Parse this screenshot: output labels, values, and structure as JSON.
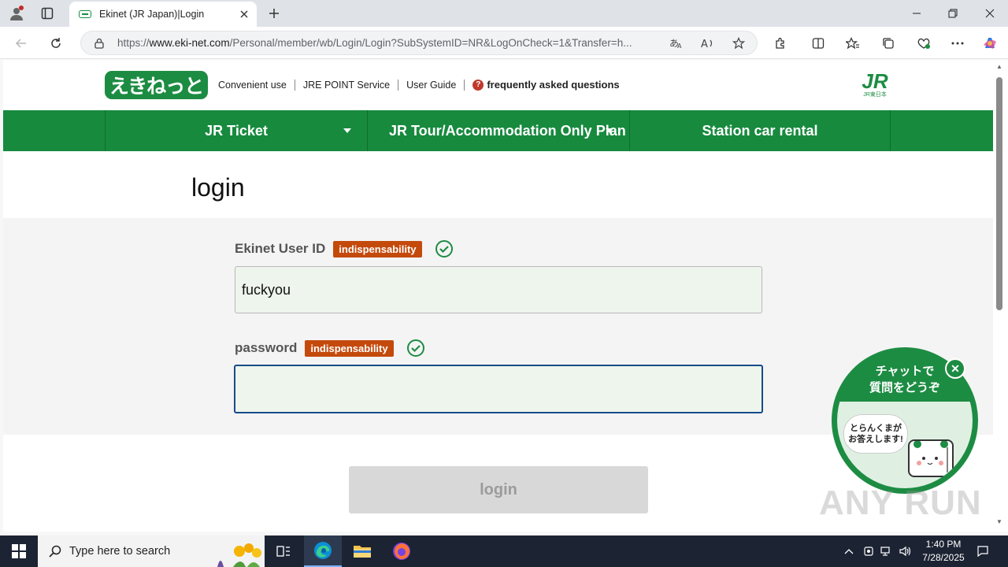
{
  "browser": {
    "tab_title": "Ekinet (JR Japan)|Login",
    "url_prefix": "https://",
    "url_host": "www.eki-net.com",
    "url_path": "/Personal/member/wb/Login/Login?SubSystemID=NR&LogOnCheck=1&Transfer=h..."
  },
  "site": {
    "logo_text": "えきねっと",
    "header_links": [
      "Convenient use",
      "JRE POINT Service",
      "User Guide",
      "frequently asked questions"
    ],
    "jr_logo_big": "JR",
    "jr_logo_small": "JR東日本",
    "global_nav": [
      "JR Ticket",
      "JR Tour/Accommodation Only Plan",
      "Station car rental"
    ]
  },
  "login": {
    "title": "login",
    "user_id_label": "Ekinet User ID",
    "user_id_badge": "indispensability",
    "user_id_value": "fuckyou",
    "password_label": "password",
    "password_badge": "indispensability",
    "password_value": "",
    "submit_label": "login"
  },
  "chat": {
    "line1": "チャットで",
    "line2": "質問をどうぞ",
    "speech_line1": "とらんくまが",
    "speech_line2": "お答えします!"
  },
  "watermark": "ANY RUN",
  "taskbar": {
    "search_placeholder": "Type here to search",
    "time": "1:40 PM",
    "date": "7/28/2025"
  },
  "colors": {
    "brand_green": "#178a3e",
    "badge_orange": "#c44a0c",
    "check_green": "#1d8c43"
  }
}
